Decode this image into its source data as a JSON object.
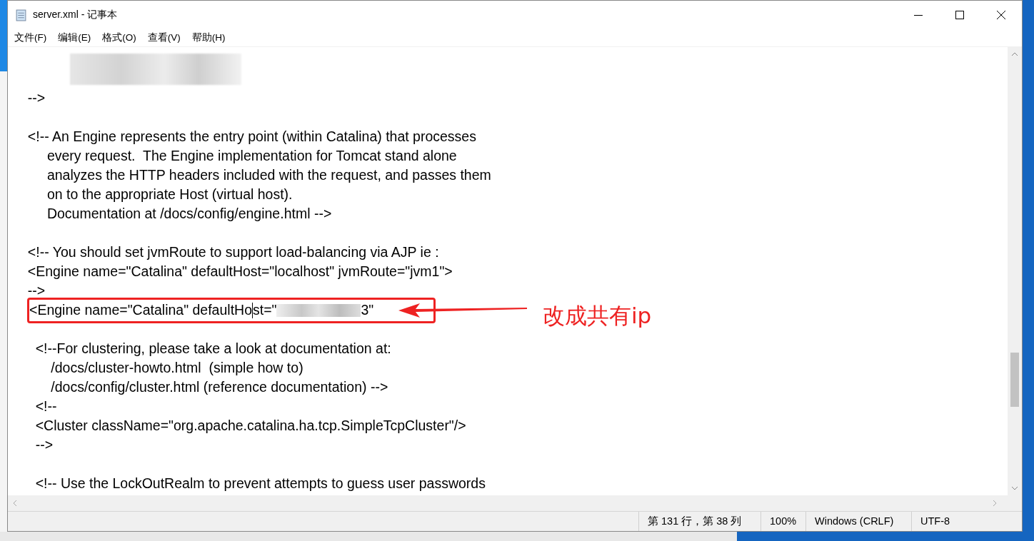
{
  "window": {
    "title": "server.xml - 记事本"
  },
  "menu": [
    "文件(F)",
    "编辑(E)",
    "格式(O)",
    "查看(V)",
    "帮助(H)"
  ],
  "editor": {
    "lines": [
      {
        "kind": "redacted"
      },
      {
        "kind": "text",
        "text": "  -->"
      },
      {
        "kind": "blank"
      },
      {
        "kind": "text",
        "text": "  <!-- An Engine represents the entry point (within Catalina) that processes"
      },
      {
        "kind": "text",
        "text": "       every request.  The Engine implementation for Tomcat stand alone"
      },
      {
        "kind": "text",
        "text": "       analyzes the HTTP headers included with the request, and passes them"
      },
      {
        "kind": "text",
        "text": "       on to the appropriate Host (virtual host)."
      },
      {
        "kind": "text",
        "text": "       Documentation at /docs/config/engine.html -->"
      },
      {
        "kind": "blank"
      },
      {
        "kind": "text",
        "text": "  <!-- You should set jvmRoute to support load-balancing via AJP ie :"
      },
      {
        "kind": "text",
        "text": "  <Engine name=\"Catalina\" defaultHost=\"localhost\" jvmRoute=\"jvm1\">"
      },
      {
        "kind": "text",
        "text": "  -->"
      },
      {
        "kind": "edited",
        "before_caret": "<Engine name=\"Catalina\" defaultHo",
        "after_caret": "st=\"",
        "after_redaction": "3\""
      },
      {
        "kind": "blank"
      },
      {
        "kind": "text",
        "text": "    <!--For clustering, please take a look at documentation at:"
      },
      {
        "kind": "text",
        "text": "        /docs/cluster-howto.html  (simple how to)"
      },
      {
        "kind": "text",
        "text": "        /docs/config/cluster.html (reference documentation) -->"
      },
      {
        "kind": "text",
        "text": "    <!--"
      },
      {
        "kind": "text",
        "text": "    <Cluster className=\"org.apache.catalina.ha.tcp.SimpleTcpCluster\"/>"
      },
      {
        "kind": "text",
        "text": "    -->"
      },
      {
        "kind": "blank"
      },
      {
        "kind": "text",
        "text": "    <!-- Use the LockOutRealm to prevent attempts to guess user passwords"
      }
    ]
  },
  "annotation": {
    "text": "改成共有ip"
  },
  "status_bar": [
    "第 131 行，第 38 列",
    "100%",
    "Windows (CRLF)",
    "UTF-8"
  ]
}
